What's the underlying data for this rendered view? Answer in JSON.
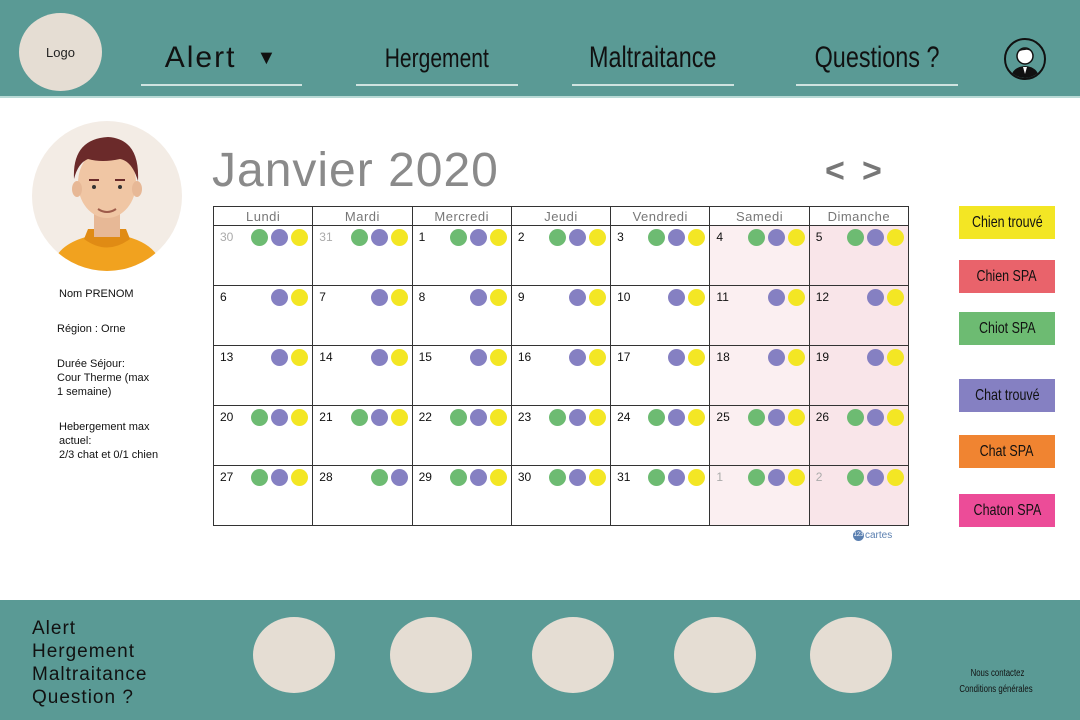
{
  "header": {
    "logo": "Logo",
    "nav": {
      "alert": "Alert",
      "alert_caret": "▼",
      "hebergement": "Hergement",
      "maltraitance": "Maltraitance",
      "questions": "Questions ?"
    },
    "user_icon": "user-avatar-icon"
  },
  "profile": {
    "name": "Nom PRENOM",
    "region": "Région : Orne",
    "duree_label": "Durée Séjour:",
    "duree_value": "Cour Therme (max",
    "duree_value2": "1 semaine)",
    "hebergement_label": "Hebergement max",
    "hebergement_label2": "actuel:",
    "hebergement_value": "2/3 chat et 0/1 chien"
  },
  "calendar": {
    "title": "Janvier 2020",
    "prev": "<",
    "next": ">",
    "weekdays": [
      "Lundi",
      "Mardi",
      "Mercredi",
      "Jeudi",
      "Vendredi",
      "Samedi",
      "Dimanche"
    ],
    "weeks": [
      [
        {
          "day": "30",
          "muted": true,
          "dots": [
            "green",
            "purple",
            "yellow"
          ]
        },
        {
          "day": "31",
          "muted": true,
          "dots": [
            "green",
            "purple",
            "yellow"
          ]
        },
        {
          "day": "1",
          "dots": [
            "green",
            "purple",
            "yellow"
          ]
        },
        {
          "day": "2",
          "dots": [
            "green",
            "purple",
            "yellow"
          ]
        },
        {
          "day": "3",
          "dots": [
            "green",
            "purple",
            "yellow"
          ]
        },
        {
          "day": "4",
          "dots": [
            "green",
            "purple",
            "yellow"
          ]
        },
        {
          "day": "5",
          "dots": [
            "green",
            "purple",
            "yellow"
          ]
        }
      ],
      [
        {
          "day": "6",
          "dots": [
            "purple",
            "yellow"
          ]
        },
        {
          "day": "7",
          "dots": [
            "purple",
            "yellow"
          ]
        },
        {
          "day": "8",
          "dots": [
            "purple",
            "yellow"
          ]
        },
        {
          "day": "9",
          "dots": [
            "purple",
            "yellow"
          ]
        },
        {
          "day": "10",
          "dots": [
            "purple",
            "yellow"
          ]
        },
        {
          "day": "11",
          "dots": [
            "purple",
            "yellow"
          ]
        },
        {
          "day": "12",
          "dots": [
            "purple",
            "yellow"
          ]
        }
      ],
      [
        {
          "day": "13",
          "dots": [
            "purple",
            "yellow"
          ]
        },
        {
          "day": "14",
          "dots": [
            "purple",
            "yellow"
          ]
        },
        {
          "day": "15",
          "dots": [
            "purple",
            "yellow"
          ]
        },
        {
          "day": "16",
          "dots": [
            "purple",
            "yellow"
          ]
        },
        {
          "day": "17",
          "dots": [
            "purple",
            "yellow"
          ]
        },
        {
          "day": "18",
          "dots": [
            "purple",
            "yellow"
          ]
        },
        {
          "day": "19",
          "dots": [
            "purple",
            "yellow"
          ]
        }
      ],
      [
        {
          "day": "20",
          "dots": [
            "green",
            "purple",
            "yellow"
          ]
        },
        {
          "day": "21",
          "dots": [
            "green",
            "purple",
            "yellow"
          ]
        },
        {
          "day": "22",
          "dots": [
            "green",
            "purple",
            "yellow"
          ]
        },
        {
          "day": "23",
          "dots": [
            "green",
            "purple",
            "yellow"
          ]
        },
        {
          "day": "24",
          "dots": [
            "green",
            "purple",
            "yellow"
          ]
        },
        {
          "day": "25",
          "dots": [
            "green",
            "purple",
            "yellow"
          ]
        },
        {
          "day": "26",
          "dots": [
            "green",
            "purple",
            "yellow"
          ]
        }
      ],
      [
        {
          "day": "27",
          "dots": [
            "green",
            "purple",
            "yellow"
          ]
        },
        {
          "day": "28",
          "dots": [
            "green",
            "purple"
          ]
        },
        {
          "day": "29",
          "dots": [
            "green",
            "purple",
            "yellow"
          ]
        },
        {
          "day": "30",
          "dots": [
            "green",
            "purple",
            "yellow"
          ]
        },
        {
          "day": "31",
          "dots": [
            "green",
            "purple",
            "yellow"
          ]
        },
        {
          "day": "1",
          "muted": true,
          "dots": [
            "green",
            "purple",
            "yellow"
          ]
        },
        {
          "day": "2",
          "muted": true,
          "dots": [
            "green",
            "purple",
            "yellow"
          ]
        }
      ]
    ],
    "watermark": "cartes",
    "watermark_logo": "123"
  },
  "legend": [
    {
      "label": "Chien trouvé",
      "color": "#f3e624"
    },
    {
      "label": "Chien SPA",
      "color": "#e9636b"
    },
    {
      "label": "Chiot SPA",
      "color": "#6dbb72"
    },
    {
      "label": "Chat trouvé",
      "color": "#8580c2"
    },
    {
      "label": "Chat SPA",
      "color": "#f08431"
    },
    {
      "label": "Chaton SPA",
      "color": "#ec4c98"
    }
  ],
  "colors": {
    "teal": "#5a9a95",
    "beige": "#e5ddd3",
    "dot_green": "#6dbb72",
    "dot_purple": "#8580c2",
    "dot_yellow": "#f3e624"
  },
  "footer": {
    "links": [
      "Alert",
      "Hergement",
      "Maltraitance",
      "Question ?"
    ],
    "contact": "Nous contactez",
    "conditions": "Conditions générales"
  }
}
